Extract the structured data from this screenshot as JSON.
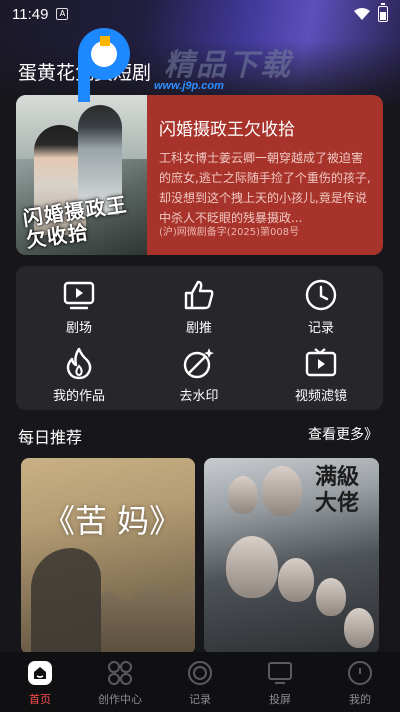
{
  "status_bar": {
    "time": "11:49"
  },
  "watermark": {
    "text": "精品下载",
    "url": "www.j9p.com"
  },
  "section": {
    "title": "蛋黄花免费短剧"
  },
  "featured": {
    "title": "闪婚摄政王欠收拾",
    "description": "工科女博士姜云卿一朝穿越成了被迫害的庶女,逃亡之际随手捡了个重伤的孩子,却没想到这个拽上天的小孩儿,竟是传说中杀人不眨眼的残暴摄政...",
    "registration": "(沪)网微剧备字(2025)第008号",
    "poster_title": "闪婚摄政王欠收拾",
    "accent": "#a8332a"
  },
  "tools": [
    {
      "label": "剧场",
      "icon": "tv-play-icon"
    },
    {
      "label": "剧推",
      "icon": "thumbs-up-icon"
    },
    {
      "label": "记录",
      "icon": "clock-icon"
    },
    {
      "label": "我的作品",
      "icon": "flame-icon"
    },
    {
      "label": "去水印",
      "icon": "magic-wand-icon"
    },
    {
      "label": "视频滤镜",
      "icon": "video-filter-icon"
    }
  ],
  "daily": {
    "title": "每日推荐",
    "more": "查看更多》"
  },
  "posters": [
    {
      "title": "《苦 妈》"
    },
    {
      "title": "满級大佬"
    }
  ],
  "tabbar": [
    {
      "label": "首页",
      "icon": "home-icon",
      "active": true
    },
    {
      "label": "创作中心",
      "icon": "grid-icon",
      "active": false
    },
    {
      "label": "记录",
      "icon": "record-icon",
      "active": false
    },
    {
      "label": "投屏",
      "icon": "screen-cast-icon",
      "active": false
    },
    {
      "label": "我的",
      "icon": "profile-icon",
      "active": false
    }
  ],
  "colors": {
    "active_tab": "#ff4d4d",
    "card_bg": "#26262b",
    "page_bg": "#17171b"
  }
}
